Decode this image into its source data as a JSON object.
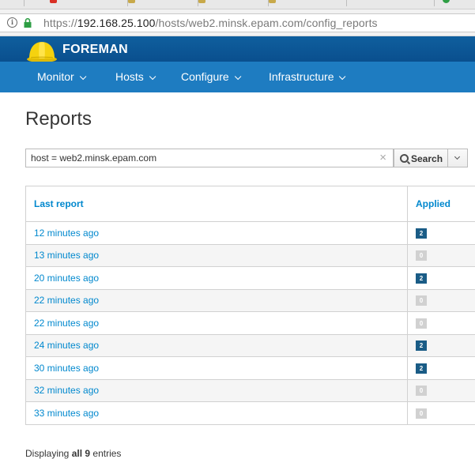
{
  "browser": {
    "url_prefix": "https://",
    "url_host": "192.168.25.100",
    "url_path": "/hosts/web2.minsk.epam.com/config_reports"
  },
  "brand": {
    "name": "FOREMAN",
    "hat_color": "#f5d20f"
  },
  "nav": [
    {
      "label": "Monitor"
    },
    {
      "label": "Hosts"
    },
    {
      "label": "Configure"
    },
    {
      "label": "Infrastructure"
    }
  ],
  "page": {
    "title": "Reports"
  },
  "search": {
    "value": "host = web2.minsk.epam.com",
    "clear_glyph": "×",
    "button_label": "Search"
  },
  "table": {
    "headers": [
      "Last report",
      "Applied"
    ],
    "rows": [
      {
        "last_report": "12 minutes ago",
        "applied": "2"
      },
      {
        "last_report": "13 minutes ago",
        "applied": "0"
      },
      {
        "last_report": "20 minutes ago",
        "applied": "2"
      },
      {
        "last_report": "22 minutes ago",
        "applied": "0"
      },
      {
        "last_report": "22 minutes ago",
        "applied": "0"
      },
      {
        "last_report": "24 minutes ago",
        "applied": "2"
      },
      {
        "last_report": "30 minutes ago",
        "applied": "2"
      },
      {
        "last_report": "32 minutes ago",
        "applied": "0"
      },
      {
        "last_report": "33 minutes ago",
        "applied": "0"
      }
    ],
    "badge_colors": {
      "nonzero": "#1a5c86",
      "zero": "#d1d1d1"
    }
  },
  "footer": {
    "prefix": "Displaying ",
    "count": "all 9",
    "suffix": " entries"
  },
  "colors": {
    "topbar": "#0a4f8e",
    "navbar": "#1e7cc1",
    "link": "#0088ce"
  }
}
